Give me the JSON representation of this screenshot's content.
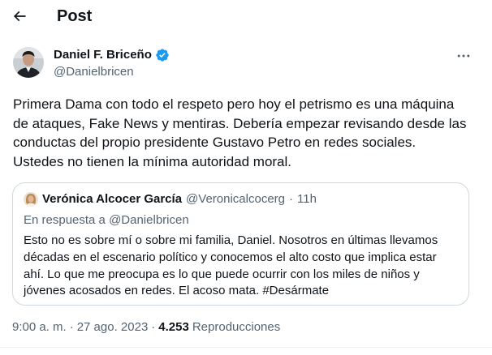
{
  "header": {
    "title": "Post",
    "back_icon": "arrow-left-icon"
  },
  "author": {
    "name": "Daniel F. Briceño",
    "handle": "@Danielbricen",
    "verified_color": "#1d9bf0"
  },
  "tweet": {
    "text": "Primera Dama con todo el respeto pero hoy el petrismo es una máquina\nde ataques, Fake News y mentiras. Debería empezar revisando desde las\nconductas del propio presidente Gustavo Petro en redes sociales.\nUstedes no tienen la mínima autoridad moral."
  },
  "quote": {
    "name": "Verónica Alcocer García",
    "handle": "@Veronicalcocerg",
    "separator": "·",
    "time": "11h",
    "reply_to": "En respuesta a @Danielbricen",
    "text": "Esto no es sobre mí o sobre mi familia, Daniel. Nosotros en últimas llevamos\ndécadas en el escenario político y conocemos el alto costo que implica estar\nahí. Lo que me preocupa es lo que puede ocurrir con los miles de niños y\njóvenes acosados en redes. El acoso mata. #Desármate"
  },
  "meta": {
    "time": "9:00 a. m.",
    "separator": "·",
    "date": "27 ago. 2023",
    "separator2": "·",
    "views_count": "4.253",
    "views_label": "Reproducciones"
  },
  "colors": {
    "text_primary": "#0f1419",
    "text_secondary": "#536471",
    "border": "#cfd9de",
    "accent": "#1d9bf0"
  }
}
